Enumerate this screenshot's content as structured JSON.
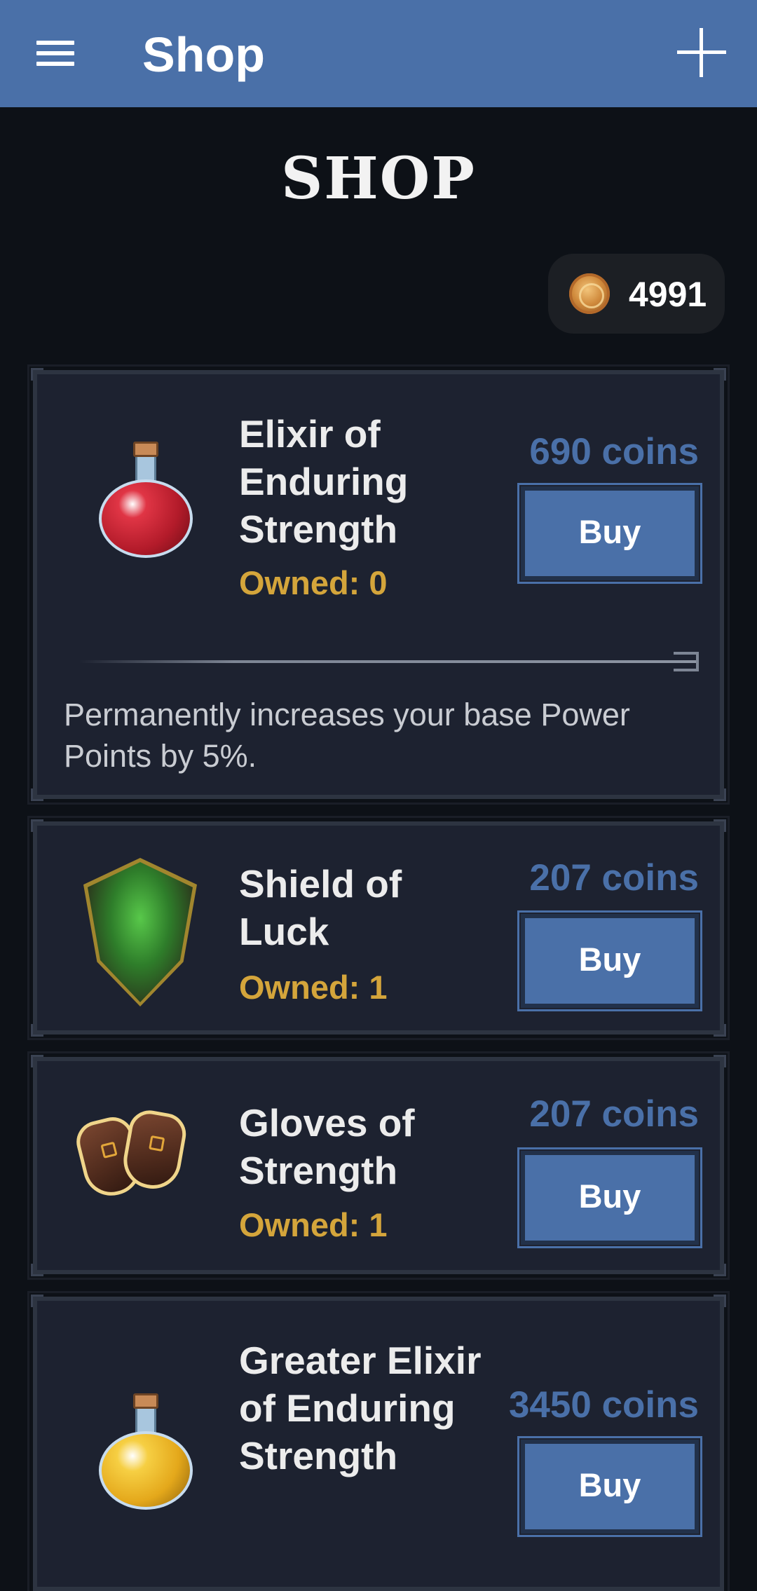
{
  "appbar": {
    "title": "Shop"
  },
  "heading": "SHOP",
  "balance": {
    "coins": "4991",
    "icon": "coin-icon"
  },
  "items": [
    {
      "name": "Elixir of Enduring Strength",
      "price": "690 coins",
      "owned": "Owned: 0",
      "buy_label": "Buy",
      "description": "Permanently increases your base Power Points by 5%.",
      "icon": "red-potion-icon"
    },
    {
      "name": "Shield of Luck",
      "price": "207 coins",
      "owned": "Owned: 1",
      "buy_label": "Buy",
      "icon": "shield-icon"
    },
    {
      "name": "Gloves of Strength",
      "price": "207 coins",
      "owned": "Owned: 1",
      "buy_label": "Buy",
      "icon": "gloves-icon"
    },
    {
      "name": "Greater Elixir of Enduring Strength",
      "price": "3450 coins",
      "buy_label": "Buy",
      "icon": "gold-potion-icon"
    }
  ],
  "colors": {
    "appbar": "#4a70a8",
    "background": "#0d1117",
    "card": "#1d2230",
    "price": "#4a70a8",
    "owned": "#d4a53b"
  }
}
